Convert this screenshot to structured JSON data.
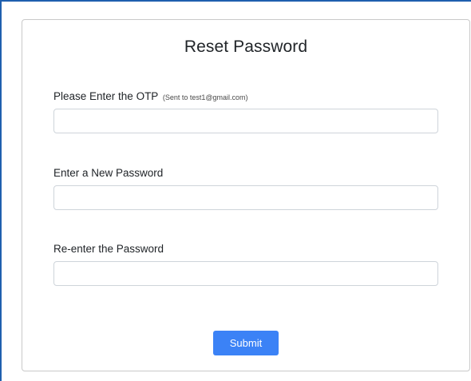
{
  "form": {
    "title": "Reset Password",
    "otp": {
      "label": "Please Enter the OTP",
      "hint": "(Sent to test1@gmail.com)",
      "value": "",
      "placeholder": ""
    },
    "new_password": {
      "label": "Enter a New Password",
      "value": "",
      "placeholder": ""
    },
    "confirm_password": {
      "label": "Re-enter the Password",
      "value": "",
      "placeholder": ""
    },
    "submit_label": "Submit"
  },
  "colors": {
    "primary": "#3b82f6",
    "frame_border": "#1f5fae",
    "card_border": "#c9c9c9",
    "input_border": "#ced4da",
    "text": "#212529"
  }
}
